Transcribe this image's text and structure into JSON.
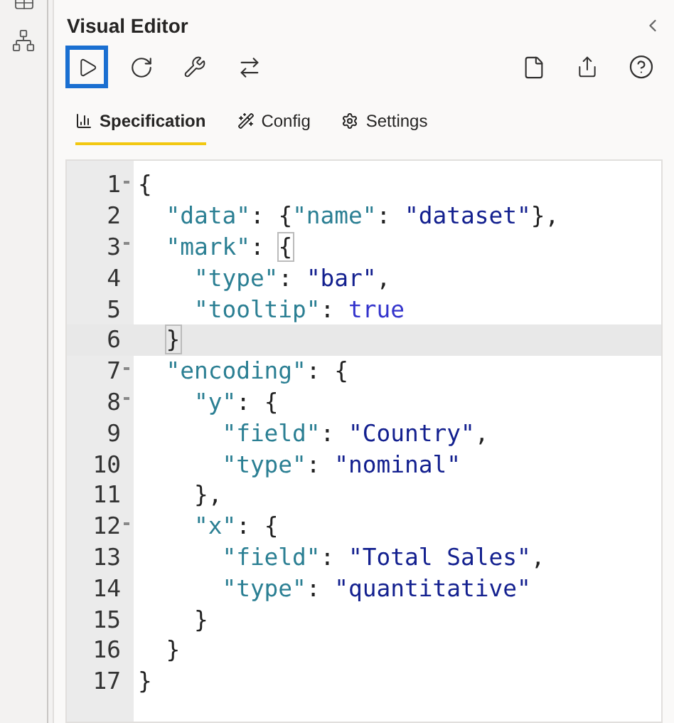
{
  "panel": {
    "title": "Visual Editor"
  },
  "toolbar": {
    "left": [
      {
        "kind": "run",
        "selected": true
      },
      {
        "kind": "replay",
        "selected": false
      },
      {
        "kind": "wrench",
        "selected": false
      },
      {
        "kind": "swap",
        "selected": false
      }
    ],
    "right": [
      {
        "kind": "file"
      },
      {
        "kind": "share"
      },
      {
        "kind": "help"
      }
    ]
  },
  "tabs": [
    {
      "label": "Specification",
      "kind": "chart",
      "selected": true
    },
    {
      "label": "Config",
      "kind": "wand",
      "selected": false
    },
    {
      "label": "Settings",
      "kind": "gear",
      "selected": false
    }
  ],
  "editor": {
    "lines": [
      {
        "number": "1",
        "foldable": true,
        "highlighted": false,
        "tokens": [
          {
            "kind": "punct",
            "text": "{"
          }
        ]
      },
      {
        "number": "2",
        "foldable": false,
        "highlighted": false,
        "tokens": [
          {
            "kind": "key",
            "text": "  \"data\""
          },
          {
            "kind": "punct",
            "text": ": {"
          },
          {
            "kind": "key",
            "text": "\"name\""
          },
          {
            "kind": "punct",
            "text": ": "
          },
          {
            "kind": "string",
            "text": "\"dataset\""
          },
          {
            "kind": "punct",
            "text": "},"
          }
        ]
      },
      {
        "number": "3",
        "foldable": true,
        "highlighted": false,
        "tokens": [
          {
            "kind": "key",
            "text": "  \"mark\""
          },
          {
            "kind": "punct",
            "text": ": "
          },
          {
            "kind": "punct",
            "text": "{",
            "matched": true
          }
        ]
      },
      {
        "number": "4",
        "foldable": false,
        "highlighted": false,
        "tokens": [
          {
            "kind": "key",
            "text": "    \"type\""
          },
          {
            "kind": "punct",
            "text": ": "
          },
          {
            "kind": "string",
            "text": "\"bar\""
          },
          {
            "kind": "punct",
            "text": ","
          }
        ]
      },
      {
        "number": "5",
        "foldable": false,
        "highlighted": false,
        "tokens": [
          {
            "kind": "key",
            "text": "    \"tooltip\""
          },
          {
            "kind": "punct",
            "text": ": "
          },
          {
            "kind": "bool",
            "text": "true"
          }
        ]
      },
      {
        "number": "6",
        "foldable": false,
        "highlighted": true,
        "tokens": [
          {
            "kind": "punct",
            "text": "  }",
            "matched": true
          }
        ]
      },
      {
        "number": "7",
        "foldable": true,
        "highlighted": false,
        "tokens": [
          {
            "kind": "key",
            "text": "  \"encoding\""
          },
          {
            "kind": "punct",
            "text": ": {"
          }
        ]
      },
      {
        "number": "8",
        "foldable": true,
        "highlighted": false,
        "tokens": [
          {
            "kind": "key",
            "text": "    \"y\""
          },
          {
            "kind": "punct",
            "text": ": {"
          }
        ]
      },
      {
        "number": "9",
        "foldable": false,
        "highlighted": false,
        "tokens": [
          {
            "kind": "key",
            "text": "      \"field\""
          },
          {
            "kind": "punct",
            "text": ": "
          },
          {
            "kind": "string",
            "text": "\"Country\""
          },
          {
            "kind": "punct",
            "text": ","
          }
        ]
      },
      {
        "number": "10",
        "foldable": false,
        "highlighted": false,
        "tokens": [
          {
            "kind": "key",
            "text": "      \"type\""
          },
          {
            "kind": "punct",
            "text": ": "
          },
          {
            "kind": "string",
            "text": "\"nominal\""
          }
        ]
      },
      {
        "number": "11",
        "foldable": false,
        "highlighted": false,
        "tokens": [
          {
            "kind": "punct",
            "text": "    },"
          }
        ]
      },
      {
        "number": "12",
        "foldable": true,
        "highlighted": false,
        "tokens": [
          {
            "kind": "key",
            "text": "    \"x\""
          },
          {
            "kind": "punct",
            "text": ": {"
          }
        ]
      },
      {
        "number": "13",
        "foldable": false,
        "highlighted": false,
        "tokens": [
          {
            "kind": "key",
            "text": "      \"field\""
          },
          {
            "kind": "punct",
            "text": ": "
          },
          {
            "kind": "string",
            "text": "\"Total Sales\""
          },
          {
            "kind": "punct",
            "text": ","
          }
        ]
      },
      {
        "number": "14",
        "foldable": false,
        "highlighted": false,
        "tokens": [
          {
            "kind": "key",
            "text": "      \"type\""
          },
          {
            "kind": "punct",
            "text": ": "
          },
          {
            "kind": "string",
            "text": "\"quantitative\""
          }
        ]
      },
      {
        "number": "15",
        "foldable": false,
        "highlighted": false,
        "tokens": [
          {
            "kind": "punct",
            "text": "    }"
          }
        ]
      },
      {
        "number": "16",
        "foldable": false,
        "highlighted": false,
        "tokens": [
          {
            "kind": "punct",
            "text": "  }"
          }
        ]
      },
      {
        "number": "17",
        "foldable": false,
        "highlighted": false,
        "tokens": [
          {
            "kind": "punct",
            "text": "}"
          }
        ]
      }
    ]
  }
}
